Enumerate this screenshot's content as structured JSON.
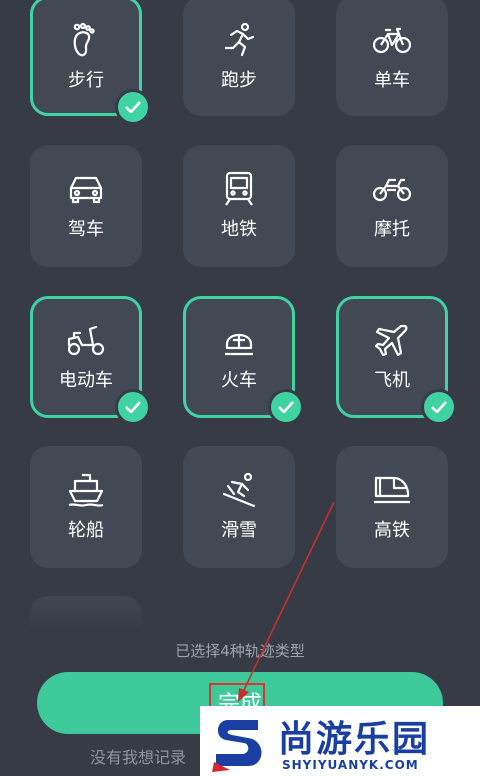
{
  "accent_color": "#3fd3a1",
  "tiles": [
    {
      "label": "步行",
      "icon": "footprints-icon",
      "selected": true
    },
    {
      "label": "跑步",
      "icon": "running-icon",
      "selected": false
    },
    {
      "label": "单车",
      "icon": "bicycle-icon",
      "selected": false
    },
    {
      "label": "驾车",
      "icon": "car-icon",
      "selected": false
    },
    {
      "label": "地铁",
      "icon": "subway-icon",
      "selected": false
    },
    {
      "label": "摩托",
      "icon": "motorcycle-icon",
      "selected": false
    },
    {
      "label": "电动车",
      "icon": "scooter-icon",
      "selected": true
    },
    {
      "label": "火车",
      "icon": "train-icon",
      "selected": true
    },
    {
      "label": "飞机",
      "icon": "airplane-icon",
      "selected": true
    },
    {
      "label": "轮船",
      "icon": "ship-icon",
      "selected": false
    },
    {
      "label": "滑雪",
      "icon": "skiing-icon",
      "selected": false
    },
    {
      "label": "高铁",
      "icon": "high-speed-rail-icon",
      "selected": false
    }
  ],
  "selected_count_text": "已选择4种轨迹类型",
  "done_button_label": "完成",
  "bottom_link_text": "没有我想记录",
  "watermark": {
    "title": "尚游乐园",
    "subtitle": "SHYIYUANYK.COM"
  }
}
